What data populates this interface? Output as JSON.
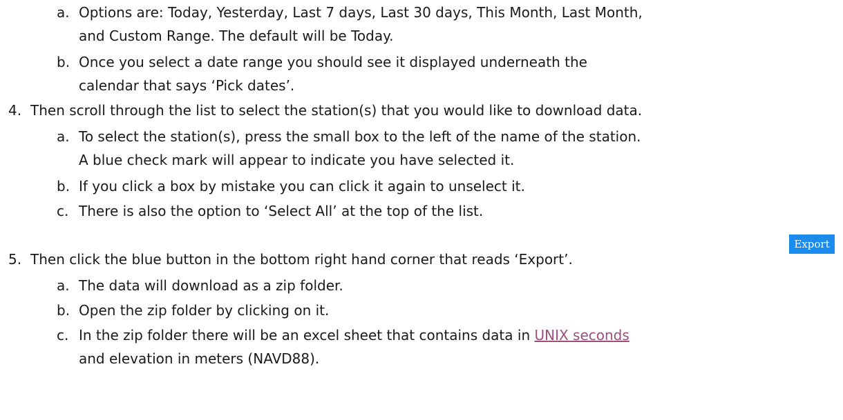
{
  "doc": {
    "item3": {
      "sub_a": {
        "marker": "a.",
        "lines": [
          "Options are: Today, Yesterday, Last 7 days, Last 30 days, This Month, Last Month,",
          "and Custom Range. The default will be Today."
        ]
      },
      "sub_b": {
        "marker": "b.",
        "lines": [
          "Once you select a date range you should see it displayed underneath the",
          "calendar that says ‘Pick dates’."
        ]
      }
    },
    "item4": {
      "marker": "4.",
      "text": "Then scroll through the list to select the station(s) that you would like to download data.",
      "sub_a": {
        "marker": "a.",
        "lines": [
          "To select the station(s), press the small box to the left of the name of the station.",
          "A blue check mark will appear to indicate you have selected it."
        ]
      },
      "sub_b": {
        "marker": "b.",
        "text": "If you click a box by mistake you can click it again to unselect it."
      },
      "sub_c": {
        "marker": "c.",
        "text": "There is also the option to ‘Select All’ at the top of the list."
      }
    },
    "item5": {
      "marker": "5.",
      "text": "Then click the blue button in the bottom right hand corner that reads ‘Export’.",
      "export_button_label": "Export",
      "sub_a": {
        "marker": "a.",
        "text": "The data will download as a zip folder."
      },
      "sub_b": {
        "marker": "b.",
        "text": "Open the zip folder by clicking on it."
      },
      "sub_c": {
        "marker": "c.",
        "line1_prefix": "In the zip folder there will be an excel sheet that contains data in ",
        "link_text": "UNIX seconds",
        "line2": "and elevation in meters (NAVD88)."
      }
    }
  }
}
